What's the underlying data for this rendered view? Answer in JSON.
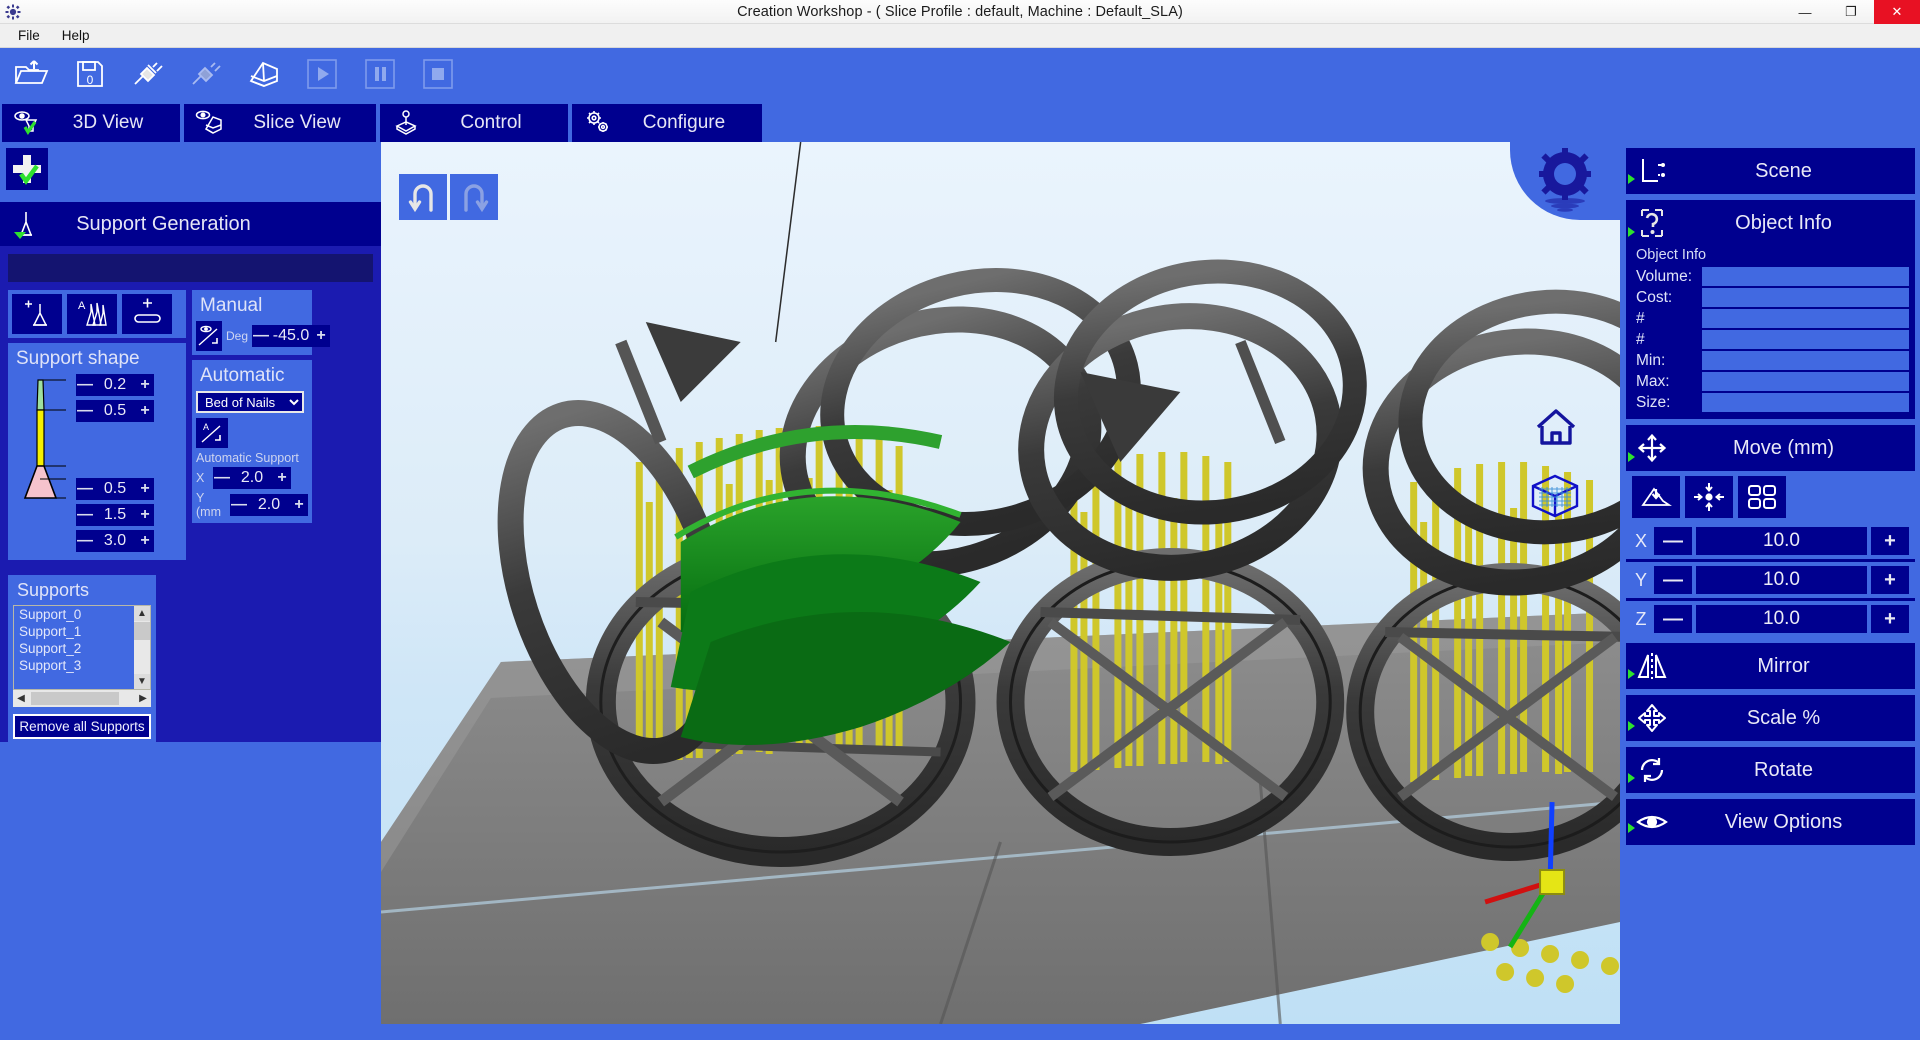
{
  "window": {
    "title": "Creation Workshop -   ( Slice Profile : default, Machine : Default_SLA)",
    "app_icon": "app-icon",
    "minimize": "—",
    "maximize": "❐",
    "close": "✕"
  },
  "menu": {
    "items": [
      {
        "label": "File"
      },
      {
        "label": "Help"
      }
    ]
  },
  "toolbar": {
    "buttons": [
      {
        "name": "open-file-icon",
        "title": "Open"
      },
      {
        "name": "save-file-icon",
        "title": "Save"
      },
      {
        "name": "connect-icon",
        "title": "Connect"
      },
      {
        "name": "disconnect-icon",
        "title": "Disconnect"
      },
      {
        "name": "slice-icon",
        "title": "Slice"
      },
      {
        "name": "play-icon",
        "title": "Start Print"
      },
      {
        "name": "pause-icon",
        "title": "Pause Print"
      },
      {
        "name": "stop-icon",
        "title": "Stop Print"
      }
    ]
  },
  "tabs": [
    {
      "label": "3D View",
      "icon": "eye-object-icon",
      "active": true
    },
    {
      "label": "Slice View",
      "icon": "eye-slice-icon",
      "active": false
    },
    {
      "label": "Control",
      "icon": "joystick-icon",
      "active": false
    },
    {
      "label": "Configure",
      "icon": "gears-icon",
      "active": false
    }
  ],
  "left_panel": {
    "add_button": {
      "name": "add-support-button",
      "icon": "plus-check-icon"
    },
    "support_generation": {
      "title": "Support Generation",
      "icon": "support-cone-icon",
      "tool_buttons": [
        {
          "name": "add-single-support-button",
          "icon": "plus-cone-icon"
        },
        {
          "name": "auto-support-button",
          "icon": "auto-cones-icon"
        },
        {
          "name": "add-base-button",
          "icon": "plus-bar-icon"
        }
      ],
      "support_shape": {
        "title": "Support shape",
        "fields": [
          {
            "label": "tip-diameter",
            "value": "0.2"
          },
          {
            "label": "upper-diameter",
            "value": "0.5"
          },
          {
            "label": "lower-diameter",
            "value": "0.5"
          },
          {
            "label": "base-height",
            "value": "1.5"
          },
          {
            "label": "base-diameter",
            "value": "3.0"
          }
        ]
      },
      "manual": {
        "title": "Manual",
        "icon": "angle-manual-icon",
        "deg_label": "Deg",
        "deg_value": "-45.0"
      },
      "automatic": {
        "title": "Automatic",
        "mode_selected": "Bed of Nails",
        "mode_options": [
          "Bed of Nails"
        ],
        "icon": "angle-auto-icon",
        "section_label": "Automatic Support",
        "x_label": "X",
        "x_value": "2.0",
        "y_label": "Y (mm",
        "y_value": "2.0"
      },
      "supports": {
        "title": "Supports",
        "items": [
          "Support_0",
          "Support_1",
          "Support_2",
          "Support_3"
        ],
        "remove_all_label": "Remove all Supports"
      }
    }
  },
  "viewport": {
    "undo": {
      "name": "undo-icon",
      "enabled": true
    },
    "redo": {
      "name": "redo-icon",
      "enabled": false
    },
    "gear_badge": "scene-gear-icon",
    "home": "home-view-icon",
    "grid": "grid-view-icon",
    "background_top": "#eaf4fd",
    "background_bottom": "#bfe0f5"
  },
  "right_panel": {
    "scene": {
      "label": "Scene",
      "icon": "scene-axis-icon"
    },
    "object_info": {
      "label": "Object Info",
      "icon": "object-info-icon",
      "subtitle": "Object Info",
      "rows": [
        {
          "key": "Volume:",
          "value": ""
        },
        {
          "key": "Cost:",
          "value": ""
        },
        {
          "key": "#",
          "value": ""
        },
        {
          "key": "#",
          "value": ""
        },
        {
          "key": "Min:",
          "value": ""
        },
        {
          "key": "Max:",
          "value": ""
        },
        {
          "key": "Size:",
          "value": ""
        }
      ]
    },
    "move": {
      "label": "Move (mm)",
      "icon": "move-arrows-icon",
      "tools": [
        {
          "name": "drop-to-platform-button",
          "icon": "drop-to-bed-icon"
        },
        {
          "name": "center-object-button",
          "icon": "center-arrows-icon"
        },
        {
          "name": "auto-arrange-button",
          "icon": "arrange-grid-icon"
        }
      ],
      "axes": [
        {
          "axis": "X",
          "value": "10.0",
          "minus": "—",
          "plus": "+"
        },
        {
          "axis": "Y",
          "value": "10.0",
          "minus": "—",
          "plus": "+"
        },
        {
          "axis": "Z",
          "value": "10.0",
          "minus": "—",
          "plus": "+"
        }
      ]
    },
    "mirror": {
      "label": "Mirror",
      "icon": "mirror-icon"
    },
    "scale": {
      "label": "Scale %",
      "icon": "scale-icon"
    },
    "rotate": {
      "label": "Rotate",
      "icon": "rotate-icon"
    },
    "view_options": {
      "label": "View Options",
      "icon": "eye-icon"
    }
  },
  "colors": {
    "accent_blue": "#4169e1",
    "panel_navy": "#00008f",
    "green_check": "#2ee12e",
    "highlight_green": "#0b7a17",
    "support_yellow": "#d6cf28"
  }
}
